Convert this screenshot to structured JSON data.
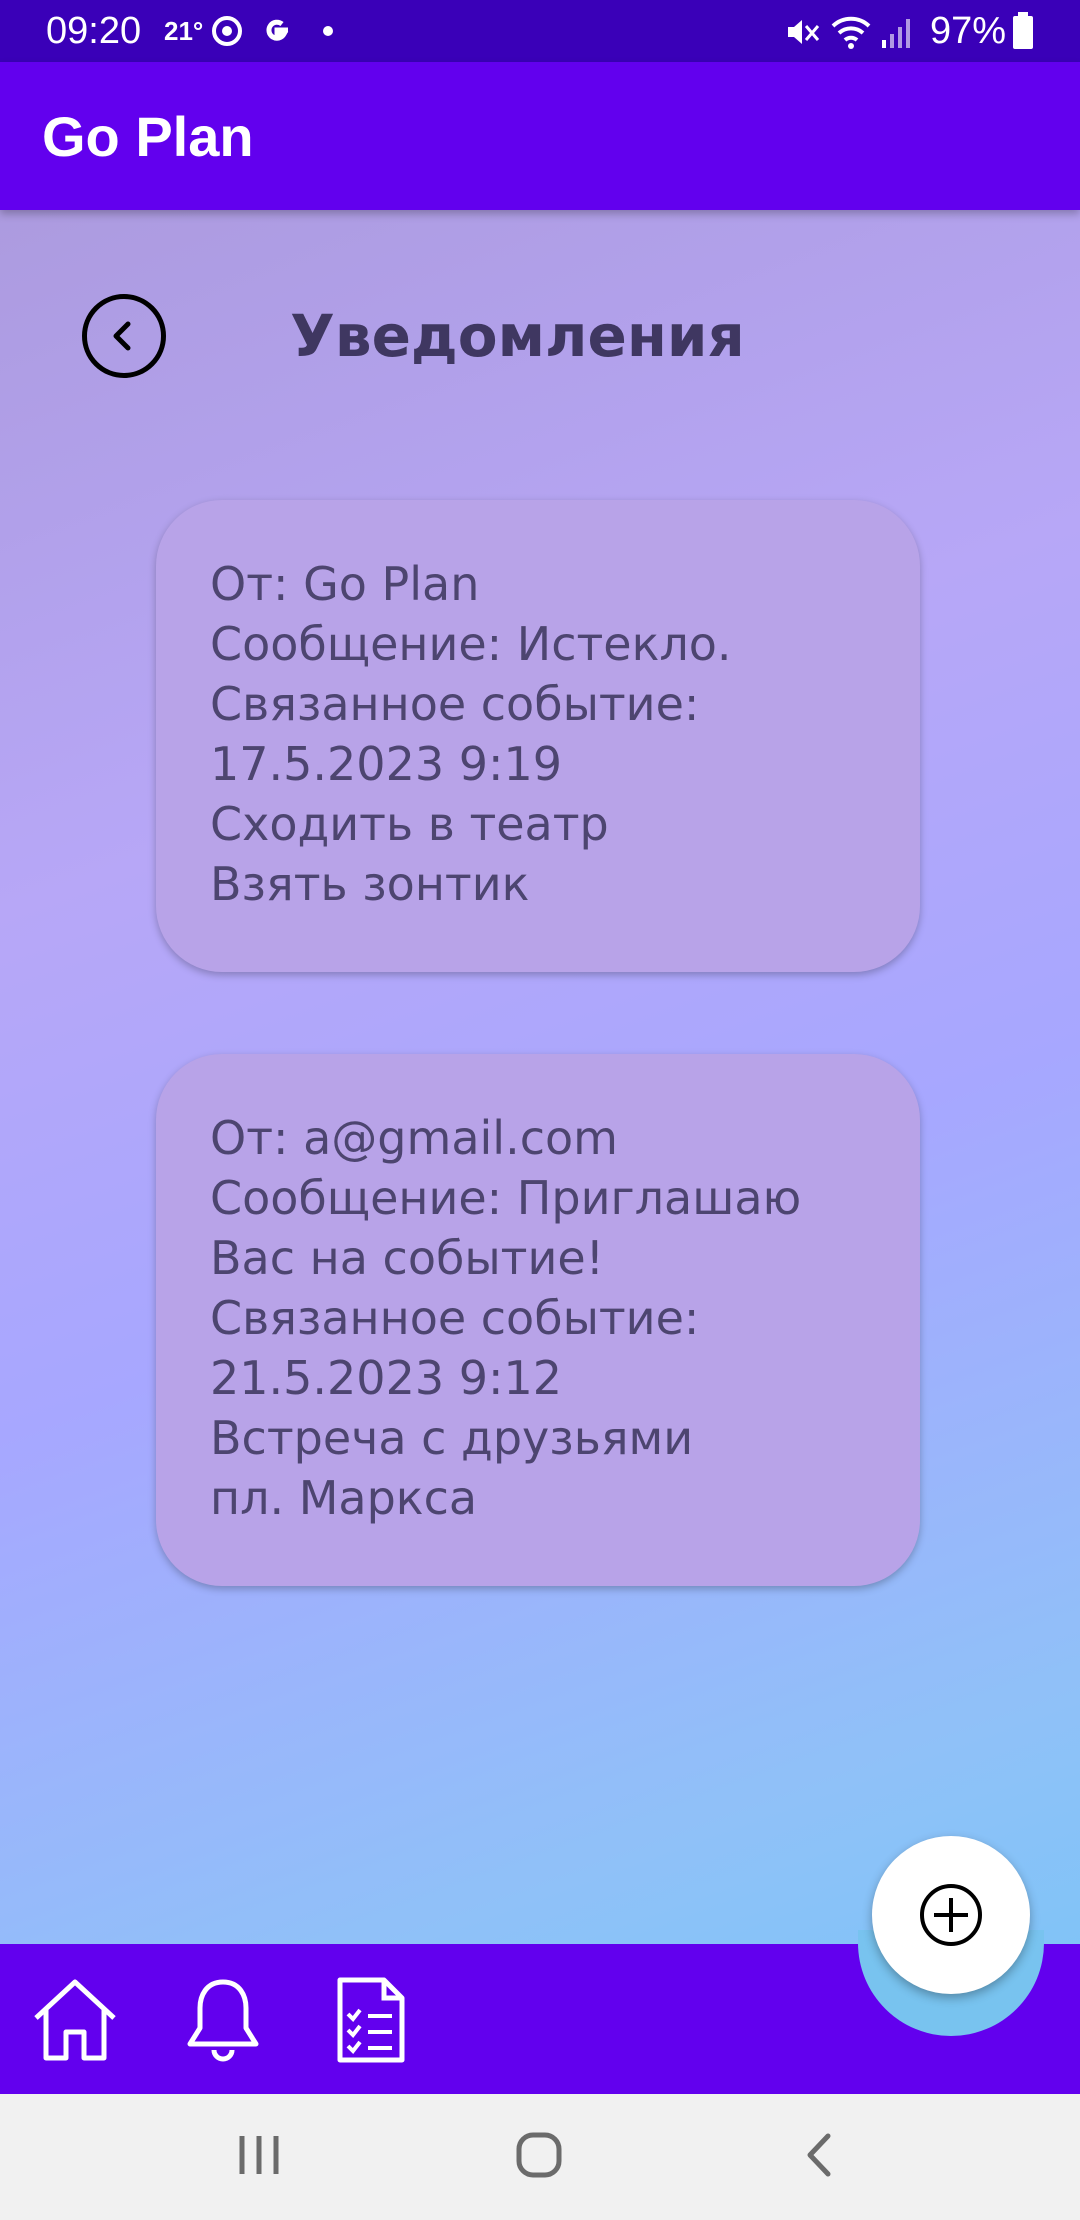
{
  "status_bar": {
    "time": "09:20",
    "temperature": "21°",
    "battery": "97%"
  },
  "app_bar": {
    "title": "Go Plan",
    "color": "#6200ee"
  },
  "page": {
    "title": "Уведомления"
  },
  "notifications": [
    {
      "from": "От: Go Plan",
      "message": "Сообщение: Истекло.",
      "related_label": "Связанное событие:",
      "datetime": "17.5.2023 9:19",
      "event_title": "Сходить в театр",
      "event_detail": "Взять зонтик"
    },
    {
      "from": "От: a@gmail.com",
      "message_line1": "Сообщение: Приглашаю",
      "message_line2": "Вас на событие!",
      "related_label": "Связанное событие:",
      "datetime": "21.5.2023 9:12",
      "event_title": "Встреча с друзьями",
      "event_detail": "пл. Маркса"
    }
  ],
  "bottom_nav": {
    "items": [
      "home-icon",
      "bell-icon",
      "checklist-icon"
    ],
    "fab_icon": "plus-circle-icon"
  },
  "system_nav": {
    "items": [
      "recents-icon",
      "home-outline-icon",
      "back-chevron-icon"
    ]
  }
}
